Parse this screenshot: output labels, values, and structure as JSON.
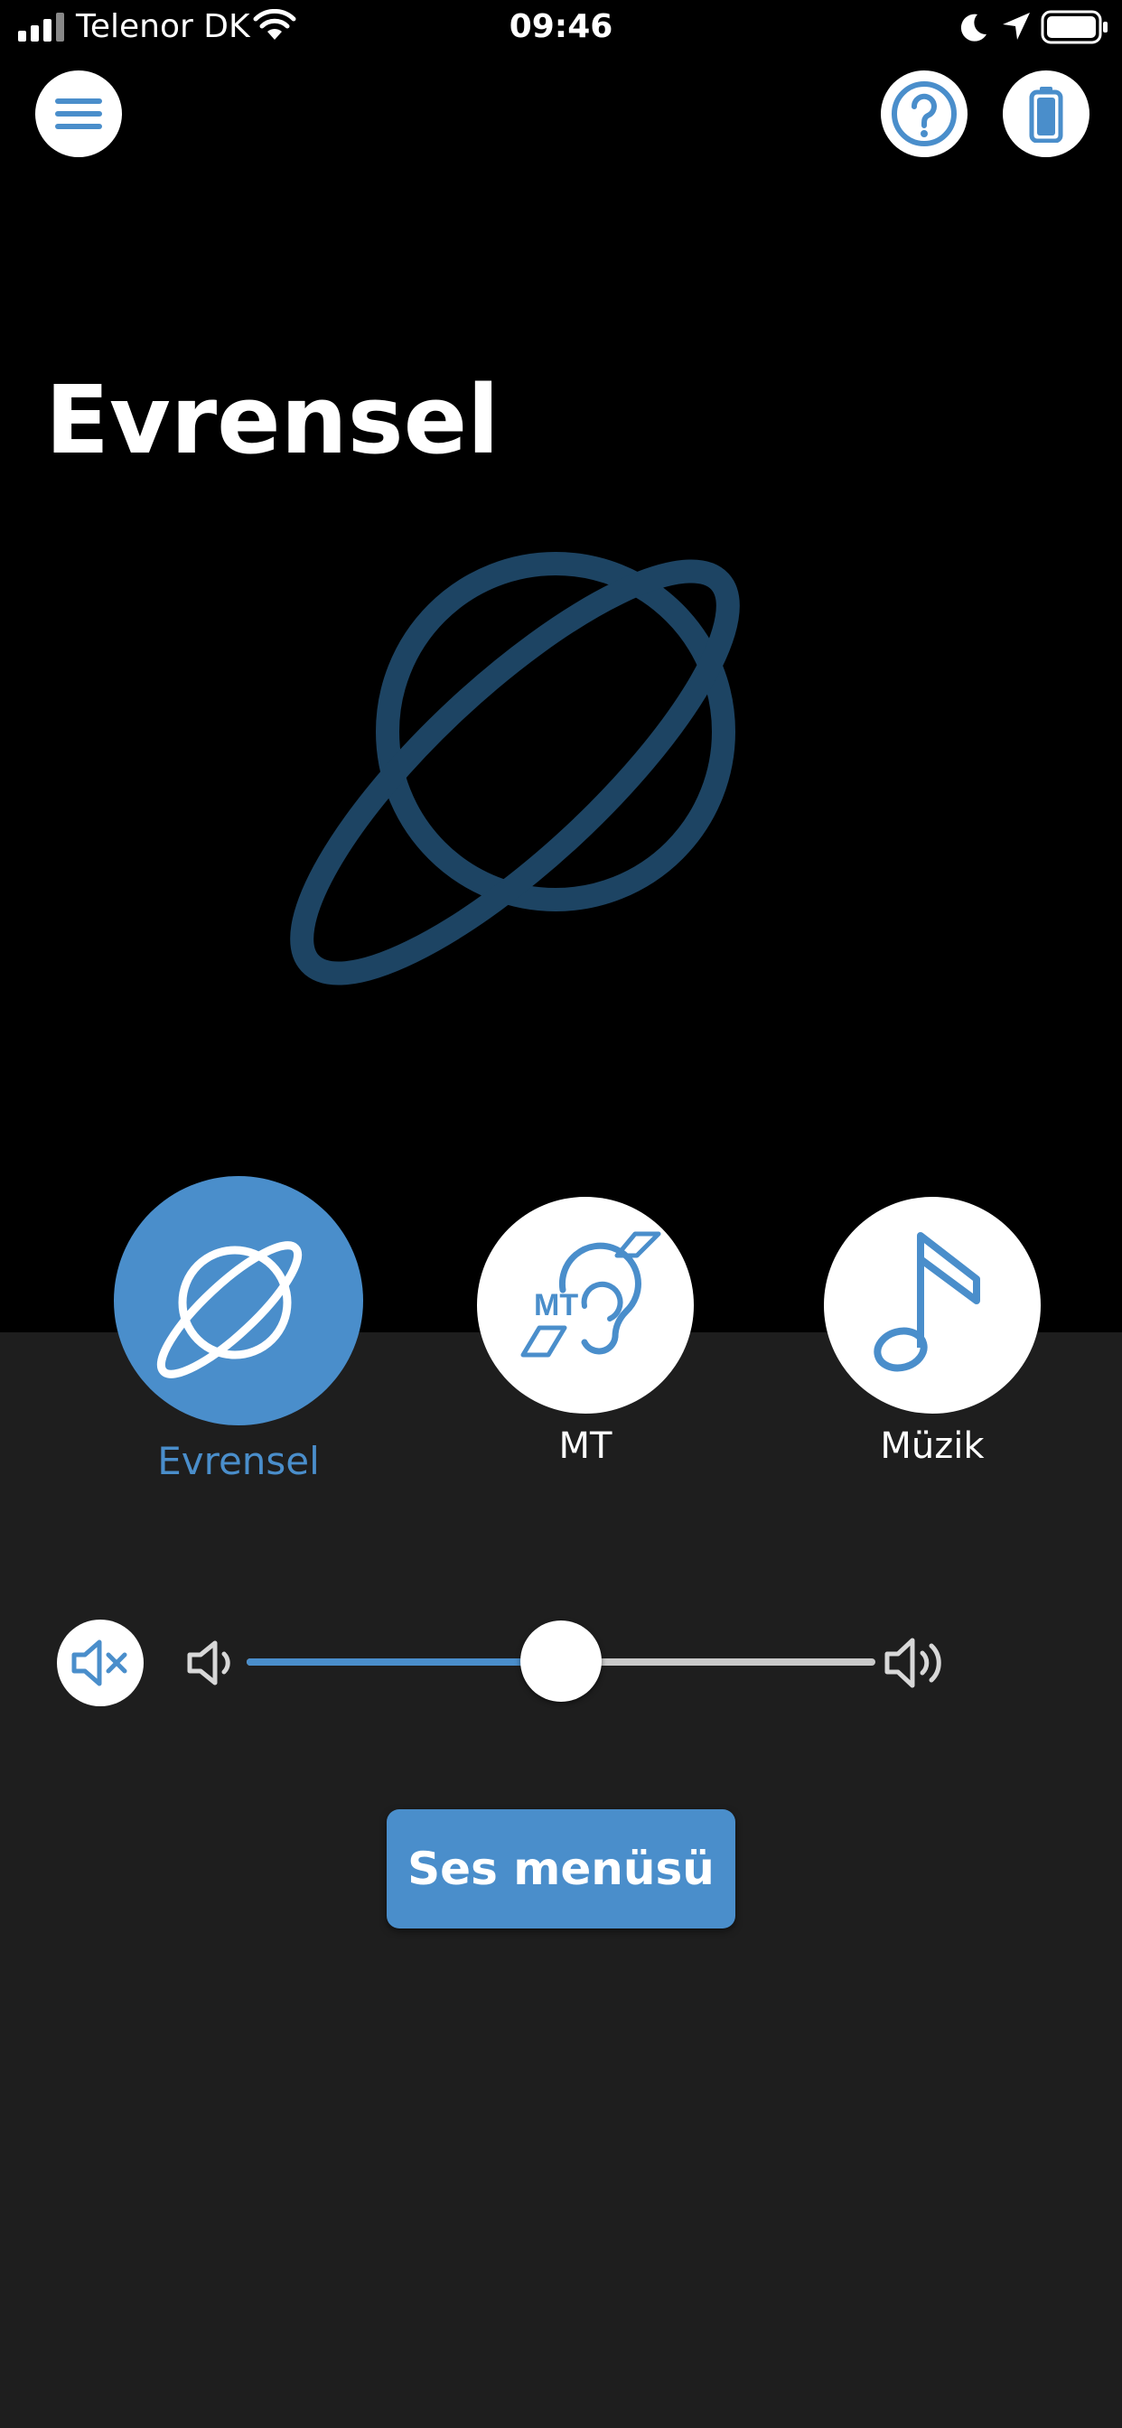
{
  "status_bar": {
    "carrier": "Telenor DK",
    "time": "09:46"
  },
  "header": {
    "menu_icon": "hamburger-menu-icon",
    "help_icon": "help-question-icon",
    "battery_icon": "battery-icon"
  },
  "program": {
    "title": "Evrensel",
    "icon": "planet-icon"
  },
  "programs": [
    {
      "label": "Evrensel",
      "icon": "planet-icon",
      "selected": true
    },
    {
      "label": "MT",
      "icon": "hearing-loop-mt-icon",
      "selected": false
    },
    {
      "label": "Müzik",
      "icon": "music-note-icon",
      "selected": false
    }
  ],
  "volume": {
    "level": 0.5,
    "mute_icon": "speaker-mute-icon",
    "low_icon": "speaker-low-icon",
    "high_icon": "speaker-high-icon"
  },
  "sound_menu_label": "Ses menüsü",
  "colors": {
    "accent": "#4a8ecb",
    "top_background": "#000000",
    "bottom_background": "#1e1e1e",
    "planet_outline": "#1d4463"
  }
}
